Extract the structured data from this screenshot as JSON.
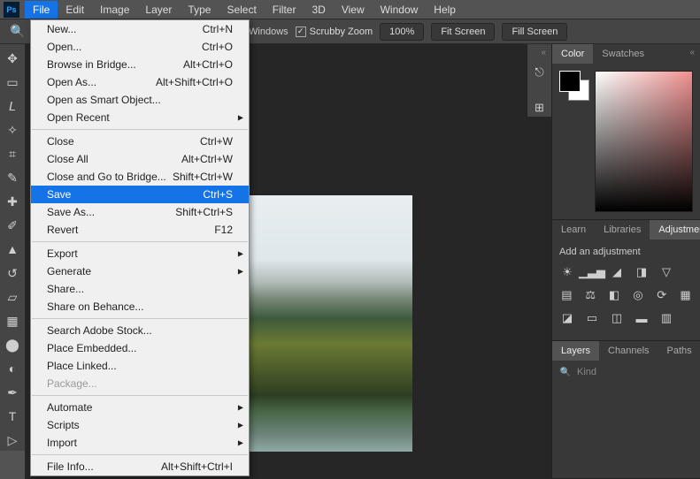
{
  "app": {
    "logo": "Ps"
  },
  "menubar": {
    "items": [
      "File",
      "Edit",
      "Image",
      "Layer",
      "Type",
      "Select",
      "Filter",
      "3D",
      "View",
      "Window",
      "Help"
    ],
    "active_index": 0
  },
  "optionsbar": {
    "all_windows_label": "om All Windows",
    "scrubby_label": "Scrubby Zoom",
    "scrubby_checked": true,
    "zoom_value": "100%",
    "fit_screen_label": "Fit Screen",
    "fill_screen_label": "Fill Screen"
  },
  "file_menu": {
    "groups": [
      [
        {
          "label": "New...",
          "shortcut": "Ctrl+N"
        },
        {
          "label": "Open...",
          "shortcut": "Ctrl+O"
        },
        {
          "label": "Browse in Bridge...",
          "shortcut": "Alt+Ctrl+O"
        },
        {
          "label": "Open As...",
          "shortcut": "Alt+Shift+Ctrl+O"
        },
        {
          "label": "Open as Smart Object..."
        },
        {
          "label": "Open Recent",
          "submenu": true
        }
      ],
      [
        {
          "label": "Close",
          "shortcut": "Ctrl+W"
        },
        {
          "label": "Close All",
          "shortcut": "Alt+Ctrl+W"
        },
        {
          "label": "Close and Go to Bridge...",
          "shortcut": "Shift+Ctrl+W"
        },
        {
          "label": "Save",
          "shortcut": "Ctrl+S",
          "highlight": true
        },
        {
          "label": "Save As...",
          "shortcut": "Shift+Ctrl+S"
        },
        {
          "label": "Revert",
          "shortcut": "F12"
        }
      ],
      [
        {
          "label": "Export",
          "submenu": true
        },
        {
          "label": "Generate",
          "submenu": true
        },
        {
          "label": "Share..."
        },
        {
          "label": "Share on Behance..."
        }
      ],
      [
        {
          "label": "Search Adobe Stock..."
        },
        {
          "label": "Place Embedded..."
        },
        {
          "label": "Place Linked..."
        },
        {
          "label": "Package...",
          "disabled": true
        }
      ],
      [
        {
          "label": "Automate",
          "submenu": true
        },
        {
          "label": "Scripts",
          "submenu": true
        },
        {
          "label": "Import",
          "submenu": true
        }
      ],
      [
        {
          "label": "File Info...",
          "shortcut": "Alt+Shift+Ctrl+I"
        }
      ]
    ]
  },
  "tools": {
    "header": "",
    "items": [
      {
        "name": "move-tool",
        "glyph": "✥"
      },
      {
        "name": "marquee-tool",
        "glyph": "▭"
      },
      {
        "name": "lasso-tool",
        "glyph": "𝘓"
      },
      {
        "name": "magic-wand-tool",
        "glyph": "✧"
      },
      {
        "name": "crop-tool",
        "glyph": "⌗"
      },
      {
        "name": "eyedropper-tool",
        "glyph": "✎"
      },
      {
        "name": "healing-brush-tool",
        "glyph": "✚"
      },
      {
        "name": "brush-tool",
        "glyph": "✐"
      },
      {
        "name": "clone-stamp-tool",
        "glyph": "▲"
      },
      {
        "name": "history-brush-tool",
        "glyph": "↺"
      },
      {
        "name": "eraser-tool",
        "glyph": "▱"
      },
      {
        "name": "gradient-tool",
        "glyph": "▦"
      },
      {
        "name": "blur-tool",
        "glyph": "⬤"
      },
      {
        "name": "dodge-tool",
        "glyph": "◐"
      },
      {
        "name": "pen-tool",
        "glyph": "✒"
      },
      {
        "name": "type-tool",
        "glyph": "T"
      },
      {
        "name": "path-selection-tool",
        "glyph": "▷"
      }
    ]
  },
  "panels": {
    "color": {
      "tabs": [
        "Color",
        "Swatches"
      ],
      "active": 0
    },
    "adjust": {
      "tabs": [
        "Learn",
        "Libraries",
        "Adjustments"
      ],
      "active": 2,
      "title": "Add an adjustment",
      "row1_names": [
        "brightness-contrast",
        "levels",
        "curves",
        "exposure",
        "vibrance"
      ],
      "row1_glyphs": [
        "☀",
        "▁▃▅",
        "◢",
        "◨",
        "▽"
      ],
      "row2_names": [
        "hue-saturation",
        "color-balance",
        "black-white",
        "photo-filter",
        "channel-mixer",
        "color-lookup"
      ],
      "row2_glyphs": [
        "▤",
        "⚖",
        "◧",
        "◎",
        "⟳",
        "▦"
      ],
      "row3_names": [
        "invert",
        "posterize",
        "threshold",
        "gradient-map",
        "selective-color"
      ],
      "row3_glyphs": [
        "◪",
        "▭",
        "◫",
        "▬",
        "▥"
      ]
    },
    "layers": {
      "tabs": [
        "Layers",
        "Channels",
        "Paths"
      ],
      "active": 0,
      "kind_label": "Kind"
    }
  },
  "dock": {
    "items": [
      {
        "name": "history-panel-icon",
        "glyph": "⎋"
      },
      {
        "name": "properties-panel-icon",
        "glyph": "⊞"
      }
    ]
  }
}
